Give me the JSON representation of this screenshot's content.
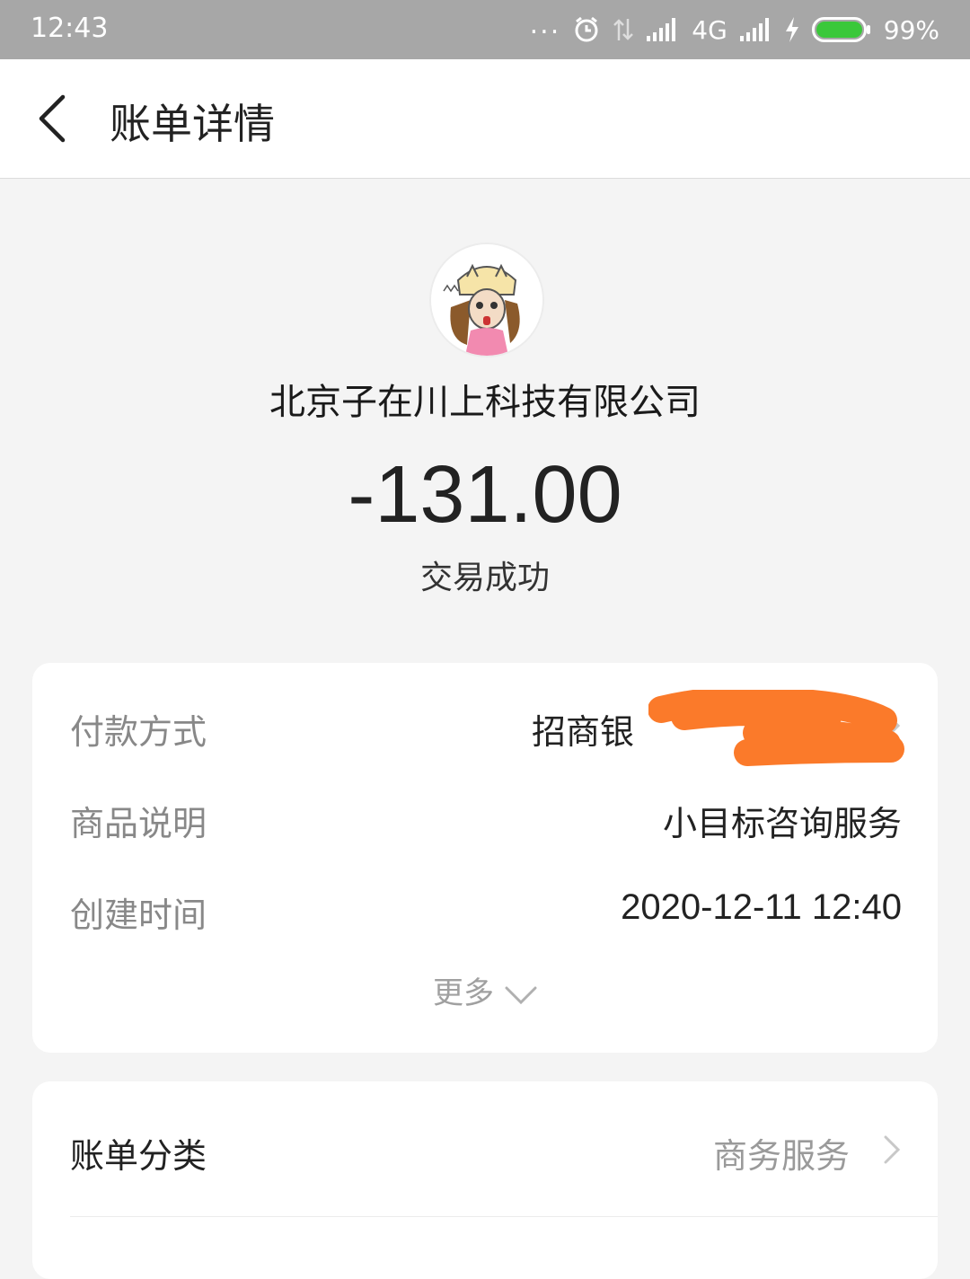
{
  "status_bar": {
    "time": "12:43",
    "dots": "...",
    "network": "4G",
    "battery": "99%"
  },
  "nav": {
    "title": "账单详情",
    "back_icon": "chevron-left-icon"
  },
  "header": {
    "merchant": "北京子在川上科技有限公司",
    "amount": "-131.00",
    "status": "交易成功"
  },
  "details": {
    "rows": [
      {
        "label": "付款方式",
        "value": "招商银"
      },
      {
        "label": "商品说明",
        "value": "小目标咨询服务"
      },
      {
        "label": "创建时间",
        "value": "2020-12-11 12:40"
      }
    ],
    "more_label": "更多"
  },
  "category": {
    "label": "账单分类",
    "value": "商务服务"
  },
  "colors": {
    "status_bar": "#a7a7a7",
    "battery": "#3ac83a",
    "redaction": "#fb7a2a"
  }
}
